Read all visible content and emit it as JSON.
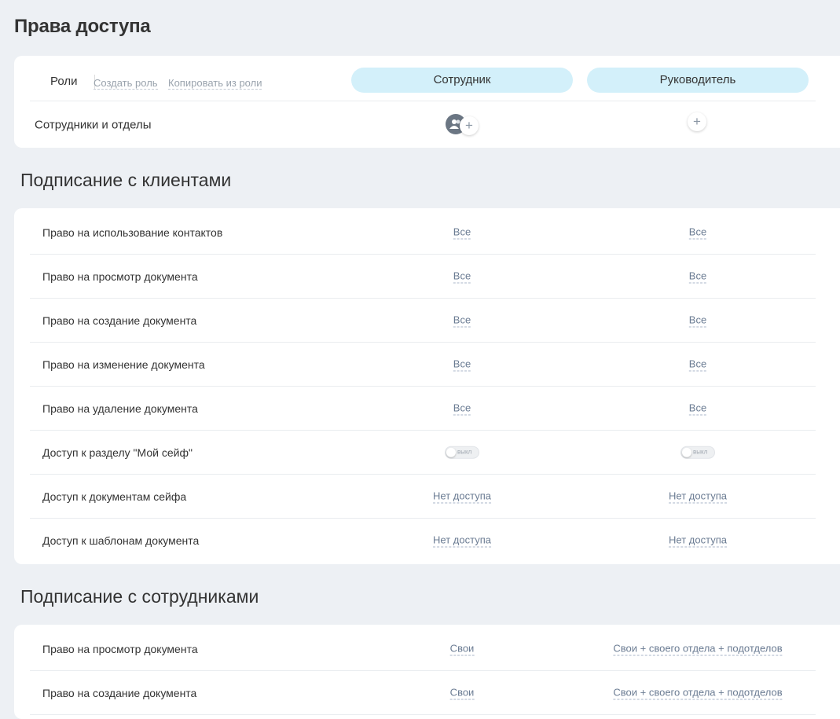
{
  "page": {
    "title": "Права доступа"
  },
  "roles": {
    "title": "Роли",
    "create_role": "Создать роль",
    "copy_from_role": "Копировать из роли",
    "columns": [
      "Сотрудник",
      "Руководитель"
    ],
    "members_label": "Сотрудники и отделы",
    "plus": "+"
  },
  "clients_section": {
    "title": "Подписание с клиентами",
    "rows": [
      {
        "label": "Право на использование контактов",
        "values": [
          "Все",
          "Все"
        ]
      },
      {
        "label": "Право на просмотр документа",
        "values": [
          "Все",
          "Все"
        ]
      },
      {
        "label": "Право на создание документа",
        "values": [
          "Все",
          "Все"
        ]
      },
      {
        "label": "Право на изменение документа",
        "values": [
          "Все",
          "Все"
        ]
      },
      {
        "label": "Право на удаление документа",
        "values": [
          "Все",
          "Все"
        ]
      },
      {
        "label": "Доступ к разделу \"Мой сейф\"",
        "values": [
          "выкл",
          "выкл"
        ]
      },
      {
        "label": "Доступ к документам сейфа",
        "values": [
          "Нет доступа",
          "Нет доступа"
        ]
      },
      {
        "label": "Доступ к шаблонам документа",
        "values": [
          "Нет доступа",
          "Нет доступа"
        ]
      }
    ]
  },
  "employees_section": {
    "title": "Подписание с сотрудниками",
    "rows": [
      {
        "label": "Право на просмотр документа",
        "values": [
          "Свои",
          "Свои + своего отдела + подотделов"
        ]
      },
      {
        "label": "Право на создание документа",
        "values": [
          "Свои",
          "Свои + своего отдела + подотделов"
        ]
      }
    ]
  }
}
